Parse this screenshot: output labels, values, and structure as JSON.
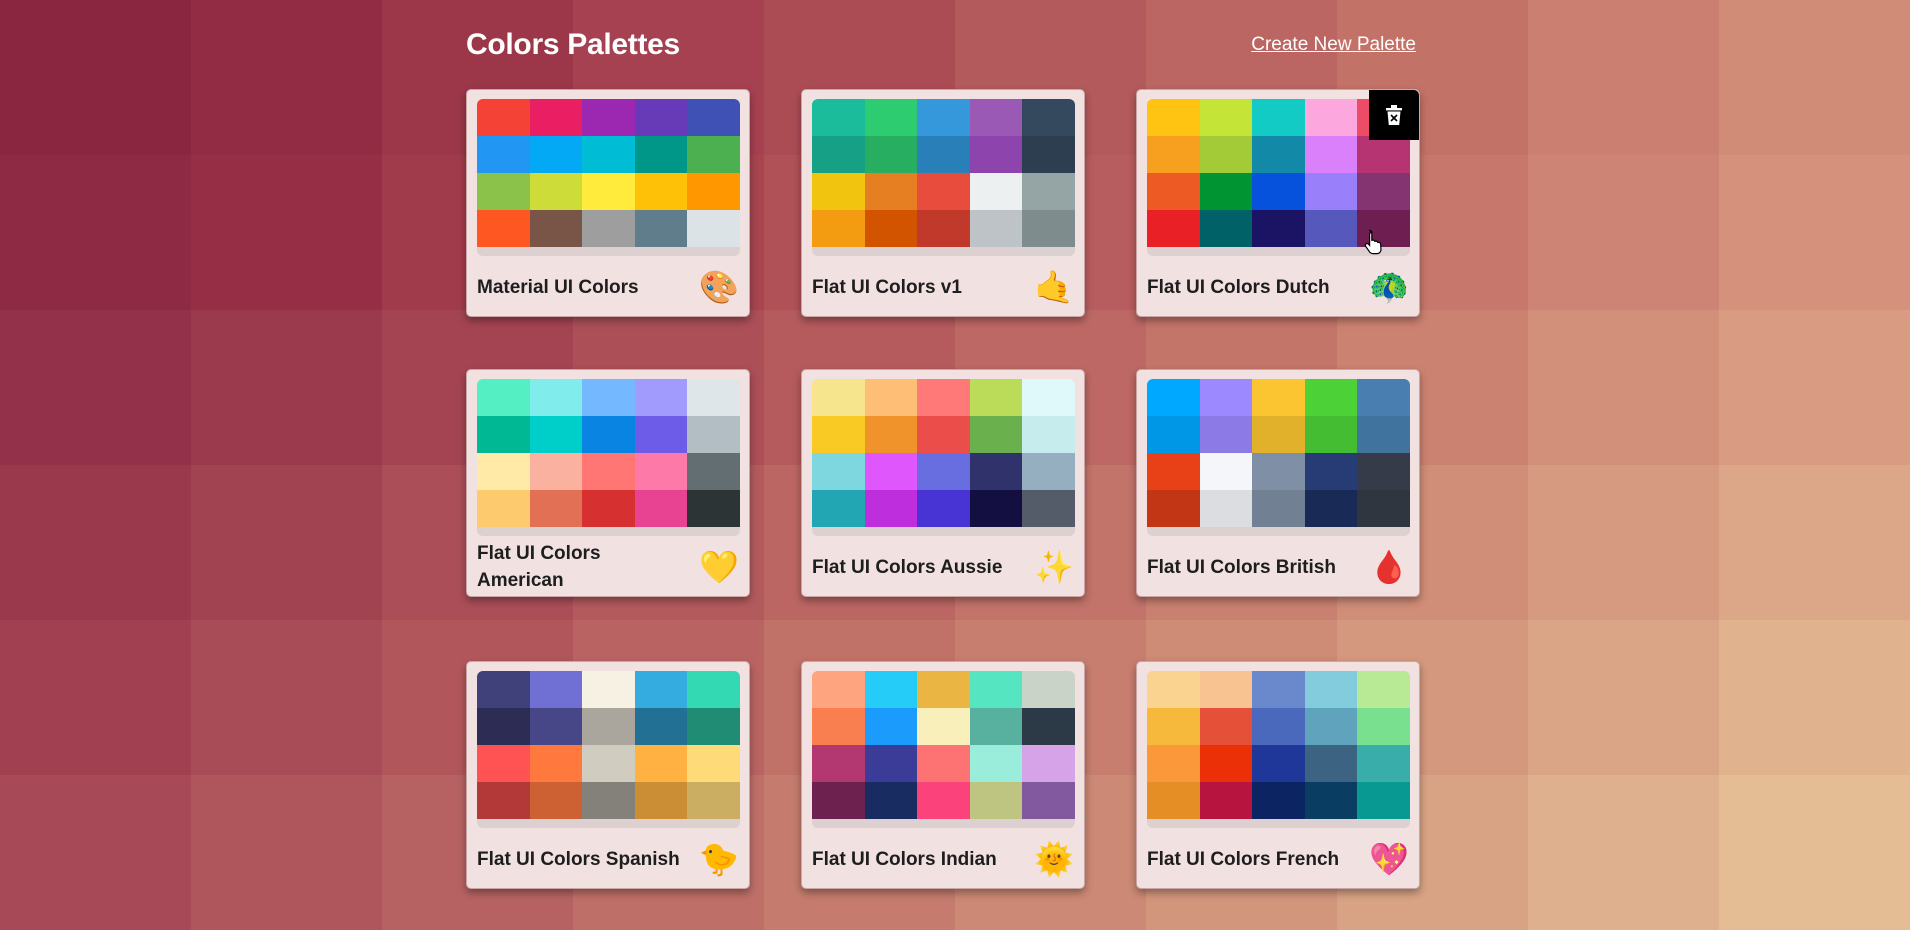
{
  "page": {
    "title": "Colors Palettes",
    "create_link": "Create New Palette"
  },
  "background": {
    "colors": [
      "#8b2641",
      "#922b44",
      "#9b3749",
      "#a54150",
      "#ab4c55",
      "#b35a5c",
      "#bb6663",
      "#c37268",
      "#ca7f70",
      "#d18c78",
      "#8e2a43",
      "#962f46",
      "#a03b4c",
      "#a8454f",
      "#b05158",
      "#b85d5f",
      "#c06a66",
      "#c7776c",
      "#cd8474",
      "#d5917c",
      "#93304a",
      "#9b3a4c",
      "#a44453",
      "#ac4f57",
      "#b55b5d",
      "#bd6864",
      "#c4756a",
      "#cb8271",
      "#d28f79",
      "#d99c82",
      "#9a384c",
      "#a24352",
      "#ab4e58",
      "#b35a5d",
      "#bb6663",
      "#c2736a",
      "#c98070",
      "#d08d78",
      "#d69a80",
      "#dca788",
      "#a04051",
      "#a84c57",
      "#b1575c",
      "#b96462",
      "#c07168",
      "#c77e6f",
      "#ce8b76",
      "#d4987e",
      "#daa586",
      "#e0b28e",
      "#a74957",
      "#af555c",
      "#b76262",
      "#be6f68",
      "#c57c6e",
      "#cc8975",
      "#d2967d",
      "#d8a385",
      "#deb08d",
      "#e4bd95"
    ]
  },
  "palettes": [
    {
      "name": "Material UI Colors",
      "emoji": "🎨",
      "colors": [
        "#f44336",
        "#e91e63",
        "#9c27b0",
        "#673ab7",
        "#3f51b5",
        "#2196f3",
        "#03a9f4",
        "#00bcd4",
        "#009688",
        "#4caf50",
        "#8bc34a",
        "#cddc39",
        "#ffeb3b",
        "#ffc107",
        "#ff9800",
        "#ff5722",
        "#795548",
        "#9e9e9e",
        "#607d8b",
        "#dce3e6"
      ]
    },
    {
      "name": "Flat UI Colors v1",
      "emoji": "🤙",
      "colors": [
        "#1abc9c",
        "#2ecc71",
        "#3498db",
        "#9b59b6",
        "#34495e",
        "#16a085",
        "#27ae60",
        "#2980b9",
        "#8e44ad",
        "#2c3e50",
        "#f1c40f",
        "#e67e22",
        "#e74c3c",
        "#ecf0f1",
        "#95a5a6",
        "#f39c12",
        "#d35400",
        "#c0392b",
        "#bdc3c7",
        "#7f8c8d"
      ]
    },
    {
      "name": "Flat UI Colors Dutch",
      "emoji": "🦚",
      "colors": [
        "#ffc312",
        "#c4e538",
        "#12cbc4",
        "#fda7df",
        "#ed4c67",
        "#f79f1f",
        "#a3cb38",
        "#1289a7",
        "#d980fa",
        "#b53471",
        "#ee5a24",
        "#009432",
        "#0652dd",
        "#9980fa",
        "#833471",
        "#ea2027",
        "#006266",
        "#1b1464",
        "#5758bb",
        "#6f1e51"
      ]
    },
    {
      "name": "Flat UI Colors American",
      "emoji": "💛",
      "colors": [
        "#55efc4",
        "#81ecec",
        "#74b9ff",
        "#a29bfe",
        "#dfe6e9",
        "#00b894",
        "#00cec9",
        "#0984e3",
        "#6c5ce7",
        "#b2bec3",
        "#ffeaa7",
        "#fab1a0",
        "#ff7675",
        "#fd79a8",
        "#636e72",
        "#fdcb6e",
        "#e17055",
        "#d63031",
        "#e84393",
        "#2d3436"
      ]
    },
    {
      "name": "Flat UI Colors Aussie",
      "emoji": "✨",
      "colors": [
        "#f6e58d",
        "#ffbe76",
        "#ff7979",
        "#badc58",
        "#dff9fb",
        "#f9ca24",
        "#f0932b",
        "#eb4d4b",
        "#6ab04c",
        "#c7ecee",
        "#7ed6df",
        "#e056fd",
        "#686de0",
        "#30336b",
        "#95afc0",
        "#22a6b3",
        "#be2edd",
        "#4834d4",
        "#130f40",
        "#535c68"
      ]
    },
    {
      "name": "Flat UI Colors British",
      "emoji": "🩸",
      "colors": [
        "#00a8ff",
        "#9c88ff",
        "#fbc531",
        "#4cd137",
        "#487eb0",
        "#0097e6",
        "#8c7ae6",
        "#e1b12c",
        "#44bd32",
        "#40739e",
        "#e84118",
        "#f5f6fa",
        "#7f8fa6",
        "#273c75",
        "#353b48",
        "#c23616",
        "#dcdde1",
        "#718093",
        "#192a56",
        "#2f3640"
      ]
    },
    {
      "name": "Flat UI Colors Spanish",
      "emoji": "🐤",
      "colors": [
        "#40407a",
        "#706fd3",
        "#f7f1e3",
        "#34ace0",
        "#33d9b2",
        "#2c2c54",
        "#474787",
        "#aaa69d",
        "#227093",
        "#218c74",
        "#ff5252",
        "#ff793f",
        "#d1ccc0",
        "#ffb142",
        "#ffda79",
        "#b33939",
        "#cd6133",
        "#84817a",
        "#cc8e35",
        "#ccae62"
      ]
    },
    {
      "name": "Flat UI Colors Indian",
      "emoji": "🌞",
      "colors": [
        "#fea47f",
        "#25ccf7",
        "#eab543",
        "#55e6c1",
        "#cad3c8",
        "#f97f51",
        "#1b9cfc",
        "#f8efba",
        "#58b19f",
        "#2c3a47",
        "#b33771",
        "#3b3b98",
        "#fd7272",
        "#9aecdb",
        "#d6a2e8",
        "#6d214f",
        "#182c61",
        "#fc427b",
        "#bdc581",
        "#82589f"
      ]
    },
    {
      "name": "Flat UI Colors French",
      "emoji": "💖",
      "colors": [
        "#fad390",
        "#f8c291",
        "#6a89cc",
        "#82ccdd",
        "#b8e994",
        "#f6b93b",
        "#e55039",
        "#4a69bd",
        "#60a3bc",
        "#78e08f",
        "#fa983a",
        "#eb2f06",
        "#1e3799",
        "#3c6382",
        "#38ada9",
        "#e58e26",
        "#b71540",
        "#0c2461",
        "#0a3d62",
        "#079992"
      ]
    }
  ],
  "icons": {
    "delete": "trash-icon",
    "cursor": "hand-pointer-icon"
  }
}
